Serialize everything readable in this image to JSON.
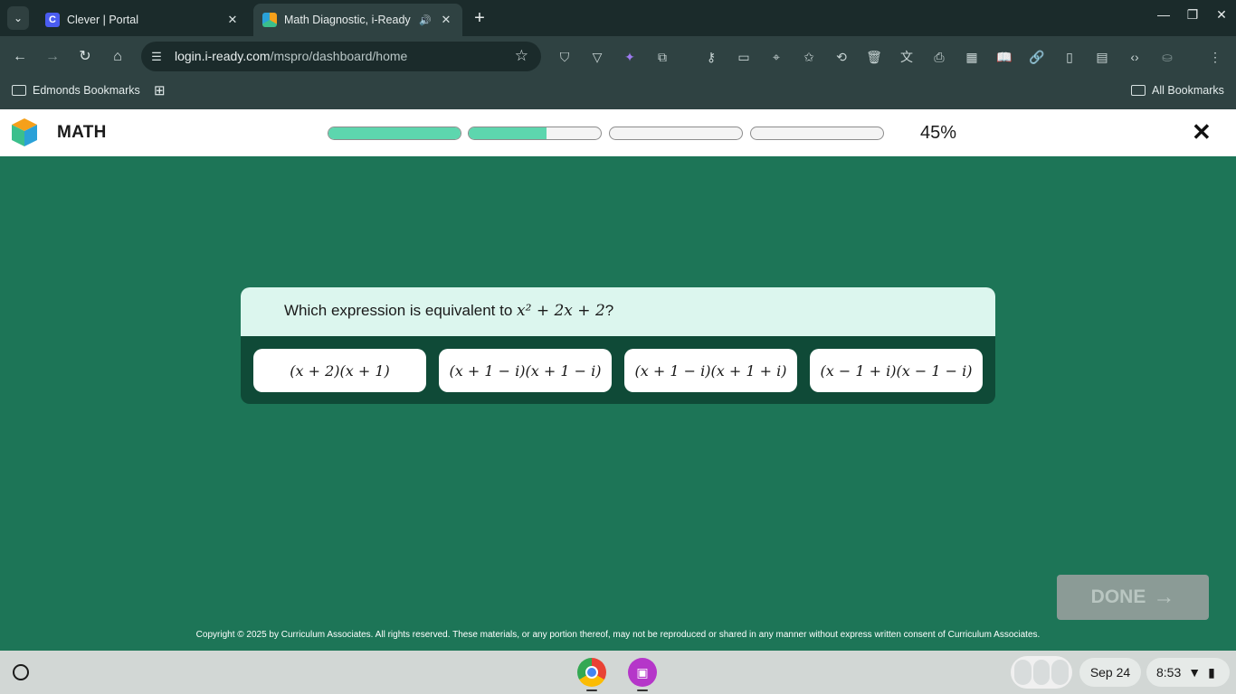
{
  "browser": {
    "tabs": [
      {
        "title": "Clever | Portal",
        "favicon": "clever-icon",
        "favicon_letter": "C",
        "active": false
      },
      {
        "title": "Math Diagnostic, i-Ready",
        "favicon": "iready-icon",
        "active": true,
        "audio": true
      }
    ],
    "url_host": "login.i-ready.com",
    "url_path": "/mspro/dashboard/home",
    "bookmarks": {
      "left_folder": "Edmonds Bookmarks",
      "right_folder": "All Bookmarks"
    }
  },
  "app": {
    "title": "MATH",
    "progress": {
      "segments": [
        1.0,
        0.59,
        0.0,
        0.0
      ],
      "percent_label": "45%"
    },
    "colors": {
      "progress_fill": "#5dd6ae",
      "page_bg": "#1d7557",
      "card_bg": "#0f4a37",
      "prompt_bg": "#dcf6ee"
    }
  },
  "question": {
    "prompt_prefix": "Which expression is equivalent to ",
    "prompt_expression": "x² + 2x + 2",
    "prompt_suffix": "?",
    "choices": [
      "(x + 2)(x + 1)",
      "(x + 1 − i)(x + 1 − i)",
      "(x + 1 − i)(x + 1 + i)",
      "(x − 1 + i)(x − 1 − i)"
    ]
  },
  "done_button": {
    "label": "DONE",
    "enabled": false
  },
  "copyright": "Copyright © 2025 by Curriculum Associates. All rights reserved. These materials, or any portion thereof, may not be reproduced or shared in any manner without express written consent of Curriculum Associates.",
  "shelf": {
    "date": "Sep 24",
    "time": "8:53"
  }
}
